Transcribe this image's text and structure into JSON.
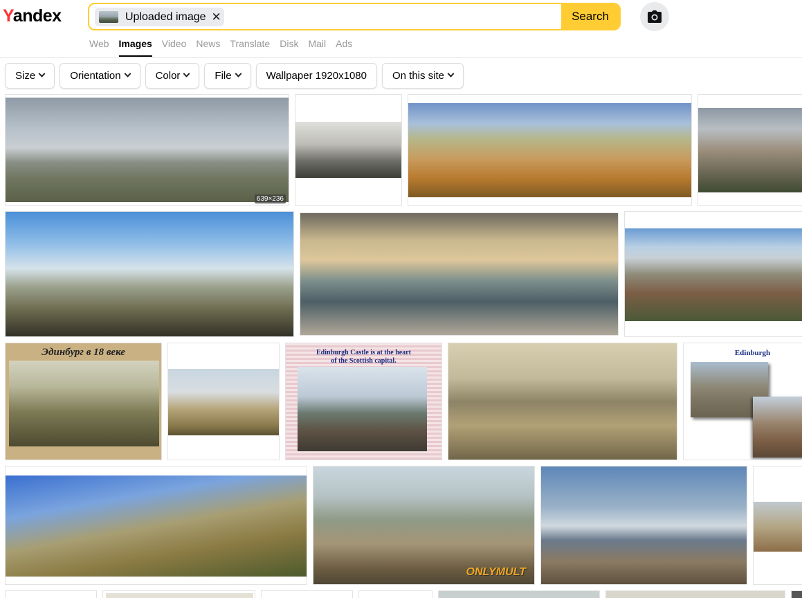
{
  "header": {
    "logo_first": "Y",
    "logo_rest": "andex",
    "search": {
      "chip_label": "Uploaded image",
      "chip_close": "✕",
      "button_label": "Search"
    },
    "tabs": [
      {
        "label": "Web"
      },
      {
        "label": "Images",
        "active": true
      },
      {
        "label": "Video"
      },
      {
        "label": "News"
      },
      {
        "label": "Translate"
      },
      {
        "label": "Disk"
      },
      {
        "label": "Mail"
      },
      {
        "label": "Ads"
      }
    ]
  },
  "filters": [
    {
      "label": "Size",
      "dropdown": true
    },
    {
      "label": "Orientation",
      "dropdown": true
    },
    {
      "label": "Color",
      "dropdown": true
    },
    {
      "label": "File",
      "dropdown": true
    },
    {
      "label": "Wallpaper 1920x1080",
      "dropdown": false
    },
    {
      "label": "On this site",
      "dropdown": true
    }
  ],
  "results": {
    "first_size_badge": "639×236",
    "overlays": {
      "edinburgh_18": "Эдинбург в 18 веке",
      "castle_caption": "Edinburgh Castle is at the heart of the Scottish capital.",
      "edinburgh_title": "Edinburgh",
      "onlymult": "ONLYMULT"
    }
  },
  "colors": {
    "accent": "#ffcc33",
    "logo_red": "#ff3333"
  }
}
